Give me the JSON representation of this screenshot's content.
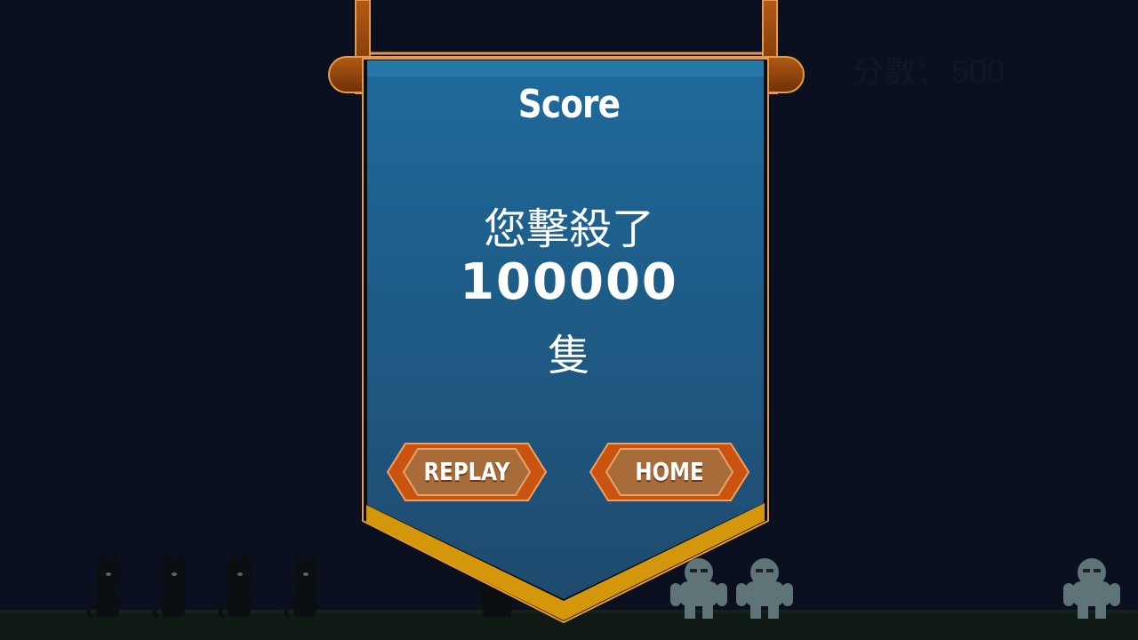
{
  "hud": {
    "score_label": "分數：",
    "score_value": "500"
  },
  "panel": {
    "title": "Score",
    "kill_prefix": "您擊殺了",
    "kill_count": "100000",
    "kill_suffix": "隻"
  },
  "buttons": {
    "replay_label": "REPLAY",
    "home_label": "HOME"
  },
  "colors": {
    "background": "#0a1020",
    "banner_blue": "#1f5f8f",
    "banner_trim_gold": "#d4960a",
    "wood": "#8a4513",
    "button_orange": "#c9530f",
    "button_tan": "#a86b3a"
  },
  "scene": {
    "enemies_left": [
      "cat-warrior-silhouette",
      "cat-warrior-silhouette",
      "cat-warrior-silhouette",
      "cat-warrior-silhouette",
      "cat-warrior-silhouette"
    ],
    "enemies_right": [
      "ogre-silhouette",
      "ogre-silhouette",
      "ogre-silhouette"
    ]
  }
}
